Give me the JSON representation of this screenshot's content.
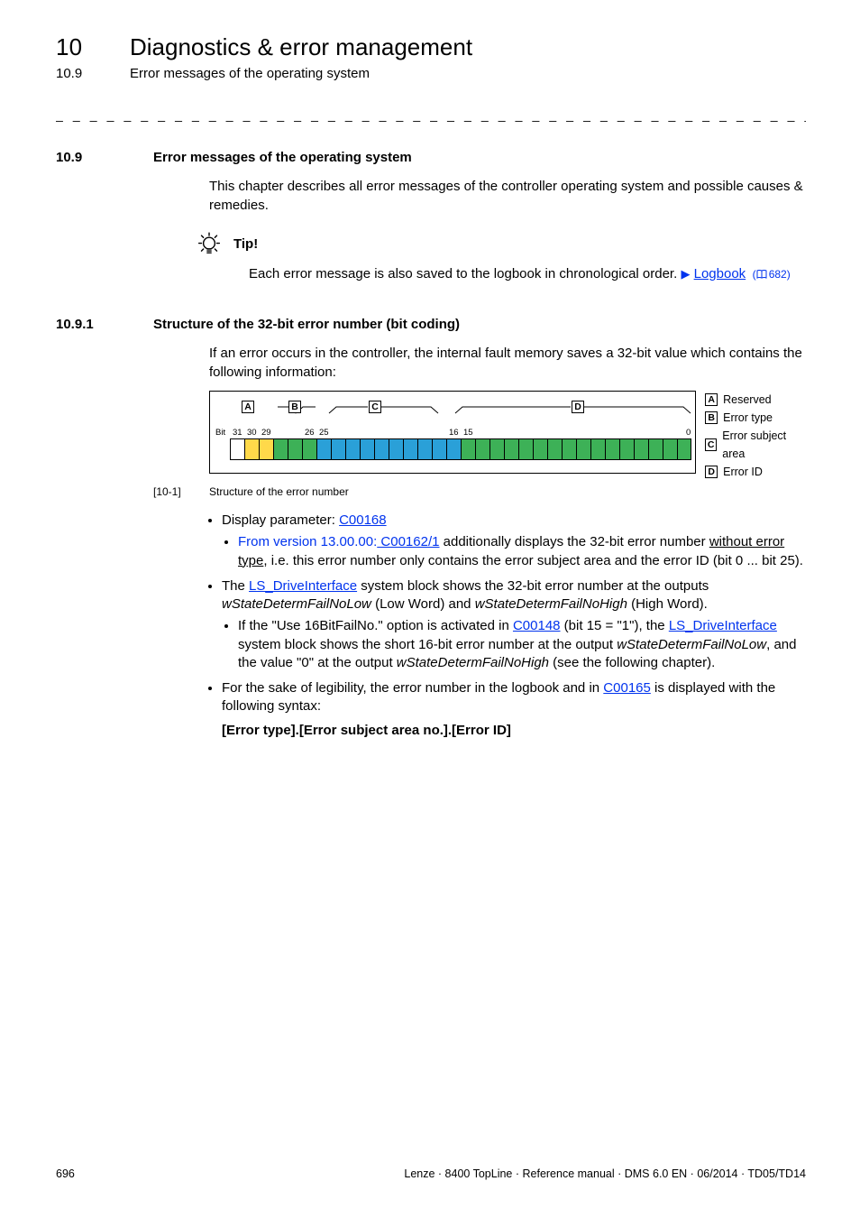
{
  "header": {
    "chapterNum": "10",
    "chapterTitle": "Diagnostics & error management",
    "subNum": "10.9",
    "subTitle": "Error messages of the operating system"
  },
  "sec109": {
    "num": "10.9",
    "title": "Error messages of the operating system",
    "intro": "This chapter describes all error messages of the controller operating system and possible causes & remedies.",
    "tipLabel": "Tip!",
    "tipTextBefore": "Each error message is also saved to the logbook in chronological order.  ",
    "tipLinkText": "Logbook",
    "tipPageRef": "682)"
  },
  "sec1091": {
    "num": "10.9.1",
    "title": "Structure of the 32-bit error number (bit coding)",
    "intro": "If an error occurs in the controller, the internal fault memory saves a 32-bit value which contains the following information:"
  },
  "diagram": {
    "labels": {
      "A": "A",
      "B": "B",
      "C": "C",
      "D": "D"
    },
    "bitsPrefix": "Bit",
    "nums": {
      "n31": "31",
      "n30": "30",
      "n29": "29",
      "n26": "26",
      "n25": "25",
      "n16": "16",
      "n15": "15",
      "n0": "0"
    },
    "legend": {
      "A": "Reserved",
      "B": "Error type",
      "C": "Error subject area",
      "D": "Error ID"
    }
  },
  "caption": {
    "num": "[10-1]",
    "text": "Structure of the error number"
  },
  "list": {
    "b1_pre": "Display parameter: ",
    "b1_link": "C00168",
    "b1a_pre": "From version 13.00.00:",
    "b1a_link": " C00162/1",
    "b1a_mid": " additionally displays the 32-bit error number ",
    "b1a_under": "without error type",
    "b1a_post": ", i.e. this error number only contains the error subject area and the error ID (bit 0 ... bit 25).",
    "b2_pre": "The ",
    "b2_link": "LS_DriveInterface",
    "b2_mid": " system block shows the 32-bit error number at the outputs ",
    "b2_it1": "wStateDetermFailNoLow",
    "b2_mid2": " (Low Word) and ",
    "b2_it2": "wStateDetermFailNoHigh",
    "b2_post": " (High Word).",
    "b2a_pre": "If the \"Use 16BitFailNo.\" option is activated in ",
    "b2a_link1": "C00148",
    "b2a_mid": " (bit 15 = \"1\"), the  ",
    "b2a_link2": "LS_DriveInterface",
    "b2a_post1": " system block shows the short 16-bit error number at the output ",
    "b2a_it1": "wStateDetermFailNoLow",
    "b2a_post2": ", and the value \"0\" at the output ",
    "b2a_it2": "wStateDetermFailNoHigh",
    "b2a_post3": " (see the following chapter).",
    "b3_pre": "For the sake of legibility, the error number in the logbook and in ",
    "b3_link": "C00165",
    "b3_post": " is displayed with the following syntax:",
    "b3_syntax": "[Error type].[Error subject area no.].[Error ID]"
  },
  "footer": {
    "page": "696",
    "right": "Lenze · 8400 TopLine · Reference manual · DMS 6.0 EN · 06/2014 · TD05/TD14"
  },
  "dashes": "_ _ _ _ _ _ _ _ _ _ _ _ _ _ _ _ _ _ _ _ _ _ _ _ _ _ _ _ _ _ _ _ _ _ _ _ _ _ _ _ _ _ _ _ _ _ _ _ _ _ _ _ _ _ _ _ _ _ _ _ _ _ _ _"
}
